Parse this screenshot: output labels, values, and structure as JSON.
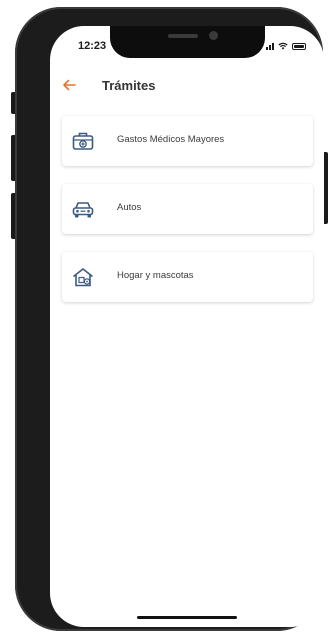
{
  "status_bar": {
    "time": "12:23",
    "icons": [
      "signal-icon",
      "wifi-icon",
      "battery-icon"
    ]
  },
  "header": {
    "back_icon": "arrow-left-icon",
    "title": "Trámites"
  },
  "items": [
    {
      "label": "Gastos Médicos Mayores",
      "icon": "medical-kit-icon"
    },
    {
      "label": "Autos",
      "icon": "car-icon"
    },
    {
      "label": "Hogar y mascotas",
      "icon": "home-pet-icon"
    }
  ],
  "colors": {
    "accent": "#e8732a",
    "icon": "#3d5a80",
    "text": "#3b3b3b",
    "title": "#333333"
  }
}
